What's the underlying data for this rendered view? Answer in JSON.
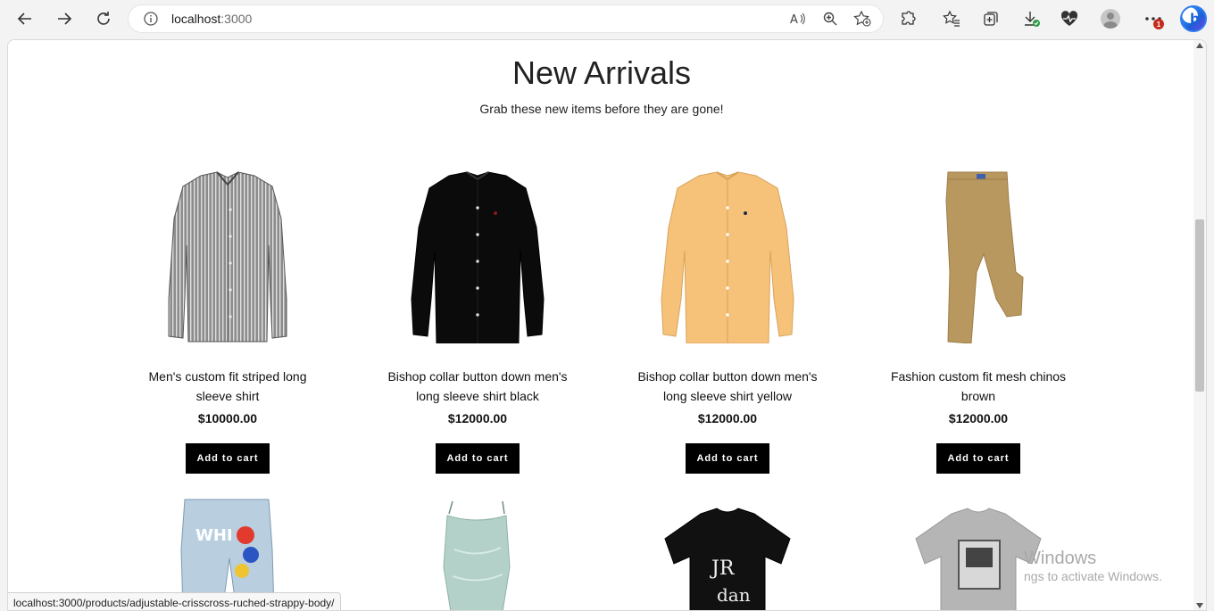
{
  "browser": {
    "url_host": "localhost",
    "url_port": ":3000",
    "notification_count": "1"
  },
  "page": {
    "title": "New Arrivals",
    "subtitle": "Grab these new items before they are gone!",
    "cart_label": "Add to cart",
    "products": [
      {
        "name": "Men's custom fit striped long sleeve shirt",
        "price": "$10000.00",
        "icon": "striped-shirt"
      },
      {
        "name": "Bishop collar button down men's long sleeve shirt black",
        "price": "$12000.00",
        "icon": "black-shirt"
      },
      {
        "name": "Bishop collar button down men's long sleeve shirt yellow",
        "price": "$12000.00",
        "icon": "yellow-shirt"
      },
      {
        "name": "Fashion custom fit mesh chinos brown",
        "price": "$12000.00",
        "icon": "chinos"
      }
    ],
    "row2_icons": [
      "ripped-jeans",
      "satin-camisole",
      "graphic-tee-black",
      "graphic-tee-grey"
    ]
  },
  "status_bar": {
    "link_url": "localhost:3000/products/adjustable-crisscross-ruched-strappy-body/"
  },
  "watermark": {
    "line1": "Windows",
    "line2": "ngs to activate Windows."
  },
  "colors": {
    "cart_button_bg": "#000000",
    "yellow_shirt": "#f6c27a",
    "chinos": "#b9985f"
  }
}
